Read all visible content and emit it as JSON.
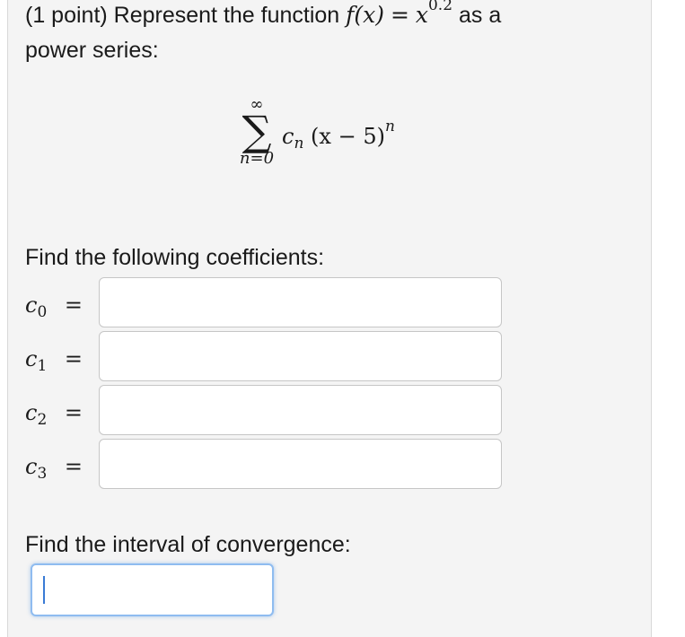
{
  "problem": {
    "prefix": "(1 point) Represent the function ",
    "func": "f(x)",
    "equals": "=",
    "base": "x",
    "exponent": "0.2",
    "suffix": "as a",
    "line2": "power series:"
  },
  "series": {
    "sum_upper": "∞",
    "sum_symbol": "∑",
    "sum_lower": "n=0",
    "coef": "c",
    "coef_sub": "n",
    "expr": "(x − 5)",
    "expr_power": "n"
  },
  "coefficients_prompt": "Find the following coefficients:",
  "coefficients": [
    {
      "var": "c",
      "sub": "0",
      "eq": "=",
      "value": ""
    },
    {
      "var": "c",
      "sub": "1",
      "eq": "=",
      "value": ""
    },
    {
      "var": "c",
      "sub": "2",
      "eq": "=",
      "value": ""
    },
    {
      "var": "c",
      "sub": "3",
      "eq": "=",
      "value": ""
    }
  ],
  "interval_prompt": "Find the interval of convergence:",
  "interval_value": ""
}
